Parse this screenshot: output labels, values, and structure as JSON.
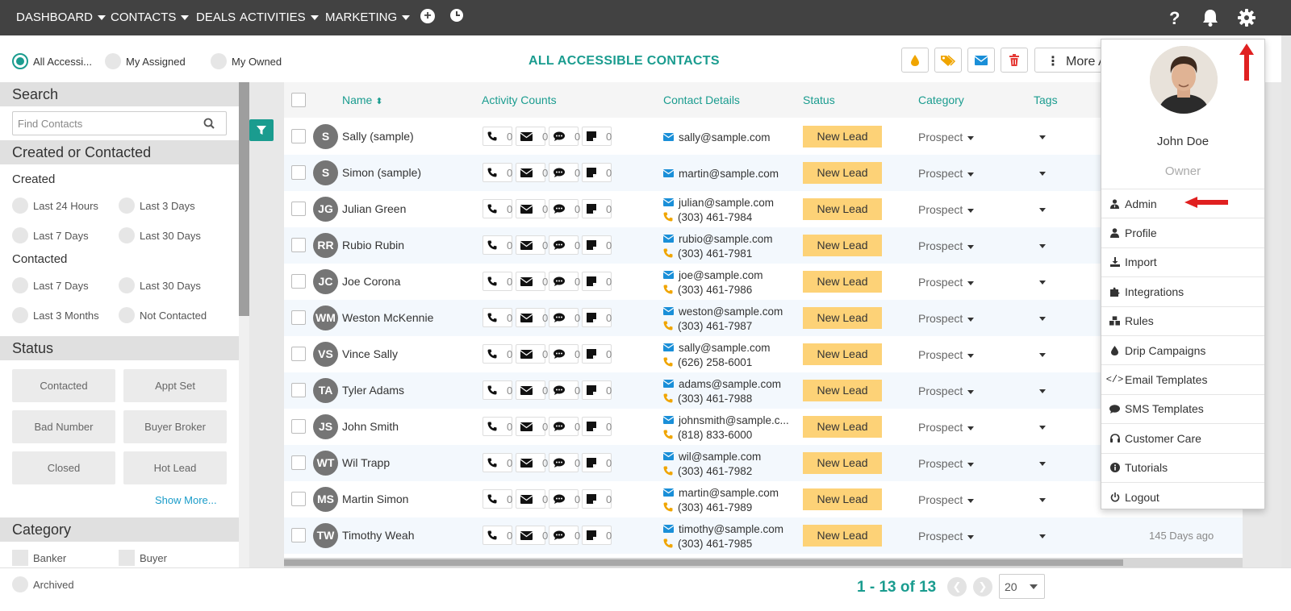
{
  "nav": {
    "items": [
      "DASHBOARD",
      "CONTACTS",
      "DEALS",
      "ACTIVITIES",
      "MARKETING"
    ],
    "icons": [
      "plus-circle-icon",
      "clock-icon",
      "help-icon",
      "bell-icon",
      "gear-icon"
    ]
  },
  "scope": {
    "all": "All Accessi...",
    "assigned": "My Assigned",
    "owned": "My Owned",
    "title": "ALL ACCESSIBLE CONTACTS",
    "more_label": "More Ac"
  },
  "sidebar": {
    "search_title": "Search",
    "search_placeholder": "Find  Contacts",
    "created_title": "Created or Contacted",
    "created_label": "Created",
    "created_options": [
      "Last 24 Hours",
      "Last 3 Days",
      "Last 7 Days",
      "Last 30 Days"
    ],
    "contacted_label": "Contacted",
    "contacted_options": [
      "Last 7 Days",
      "Last 30 Days",
      "Last 3 Months",
      "Not Contacted"
    ],
    "status_title": "Status",
    "status_buttons": [
      "Contacted",
      "Appt Set",
      "Bad Number",
      "Buyer Broker",
      "Closed",
      "Hot Lead"
    ],
    "show_more": "Show More...",
    "category_title": "Category",
    "category_options": [
      "Banker",
      "Buyer"
    ],
    "archived": "Archived"
  },
  "table": {
    "headers": [
      "Name",
      "Activity Counts",
      "Contact Details",
      "Status",
      "Category",
      "Tags"
    ],
    "rows": [
      {
        "initials": "S",
        "name": "Sally (sample)",
        "counts": [
          "0",
          "0",
          "0",
          "0"
        ],
        "email": "sally@sample.com",
        "phone": "",
        "status": "New Lead",
        "category": "Prospect",
        "ago": ""
      },
      {
        "initials": "S",
        "name": "Simon (sample)",
        "counts": [
          "0",
          "0",
          "0",
          "0"
        ],
        "email": "martin@sample.com",
        "phone": "",
        "status": "New Lead",
        "category": "Prospect",
        "ago": ""
      },
      {
        "initials": "JG",
        "name": "Julian Green",
        "counts": [
          "0",
          "0",
          "0",
          "0"
        ],
        "email": "julian@sample.com",
        "phone": "(303) 461-7984",
        "status": "New Lead",
        "category": "Prospect",
        "ago": ""
      },
      {
        "initials": "RR",
        "name": "Rubio Rubin",
        "counts": [
          "0",
          "0",
          "0",
          "0"
        ],
        "email": "rubio@sample.com",
        "phone": "(303) 461-7981",
        "status": "New Lead",
        "category": "Prospect",
        "ago": ""
      },
      {
        "initials": "JC",
        "name": "Joe Corona",
        "counts": [
          "0",
          "0",
          "0",
          "0"
        ],
        "email": "joe@sample.com",
        "phone": "(303) 461-7986",
        "status": "New Lead",
        "category": "Prospect",
        "ago": ""
      },
      {
        "initials": "WM",
        "name": "Weston McKennie",
        "counts": [
          "0",
          "0",
          "0",
          "0"
        ],
        "email": "weston@sample.com",
        "phone": "(303) 461-7987",
        "status": "New Lead",
        "category": "Prospect",
        "ago": ""
      },
      {
        "initials": "VS",
        "name": "Vince Sally",
        "counts": [
          "0",
          "0",
          "0",
          "0"
        ],
        "email": "sally@sample.com",
        "phone": "(626) 258-6001",
        "status": "New Lead",
        "category": "Prospect",
        "ago": ""
      },
      {
        "initials": "TA",
        "name": "Tyler Adams",
        "counts": [
          "0",
          "0",
          "0",
          "0"
        ],
        "email": "adams@sample.com",
        "phone": "(303) 461-7988",
        "status": "New Lead",
        "category": "Prospect",
        "ago": ""
      },
      {
        "initials": "JS",
        "name": "John Smith",
        "counts": [
          "0",
          "0",
          "0",
          "0"
        ],
        "email": "johnsmith@sample.c...",
        "phone": "(818) 833-6000",
        "status": "New Lead",
        "category": "Prospect",
        "ago": ""
      },
      {
        "initials": "WT",
        "name": "Wil Trapp",
        "counts": [
          "0",
          "0",
          "0",
          "0"
        ],
        "email": "wil@sample.com",
        "phone": "(303) 461-7982",
        "status": "New Lead",
        "category": "Prospect",
        "ago": ""
      },
      {
        "initials": "MS",
        "name": "Martin Simon",
        "counts": [
          "0",
          "0",
          "0",
          "0"
        ],
        "email": "martin@sample.com",
        "phone": "(303) 461-7989",
        "status": "New Lead",
        "category": "Prospect",
        "ago": ""
      },
      {
        "initials": "TW",
        "name": "Timothy Weah",
        "counts": [
          "0",
          "0",
          "0",
          "0"
        ],
        "email": "timothy@sample.com",
        "phone": "(303) 461-7985",
        "status": "New Lead",
        "category": "Prospect",
        "ago": "145 Days ago"
      }
    ]
  },
  "footer": {
    "pager": "1 - 13 of 13",
    "per_page": "20"
  },
  "menu": {
    "name": "John Doe",
    "role": "Owner",
    "items": [
      {
        "label": "Admin",
        "icon": "user-tie-icon"
      },
      {
        "label": "Profile",
        "icon": "user-icon"
      },
      {
        "label": "Import",
        "icon": "download-icon"
      },
      {
        "label": "Integrations",
        "icon": "puzzle-icon"
      },
      {
        "label": "Rules",
        "icon": "cubes-icon"
      },
      {
        "label": "Drip Campaigns",
        "icon": "drop-icon"
      },
      {
        "label": "Email Templates",
        "icon": "code-icon"
      },
      {
        "label": "SMS Templates",
        "icon": "comment-icon"
      },
      {
        "label": "Customer Care",
        "icon": "headset-icon"
      },
      {
        "label": "Tutorials",
        "icon": "info-icon"
      },
      {
        "label": "Logout",
        "icon": "power-icon"
      }
    ]
  },
  "colors": {
    "accent": "#1a9c8f",
    "nav_bg": "#424242",
    "lead": "#fdd277",
    "arrow": "#e02020"
  }
}
